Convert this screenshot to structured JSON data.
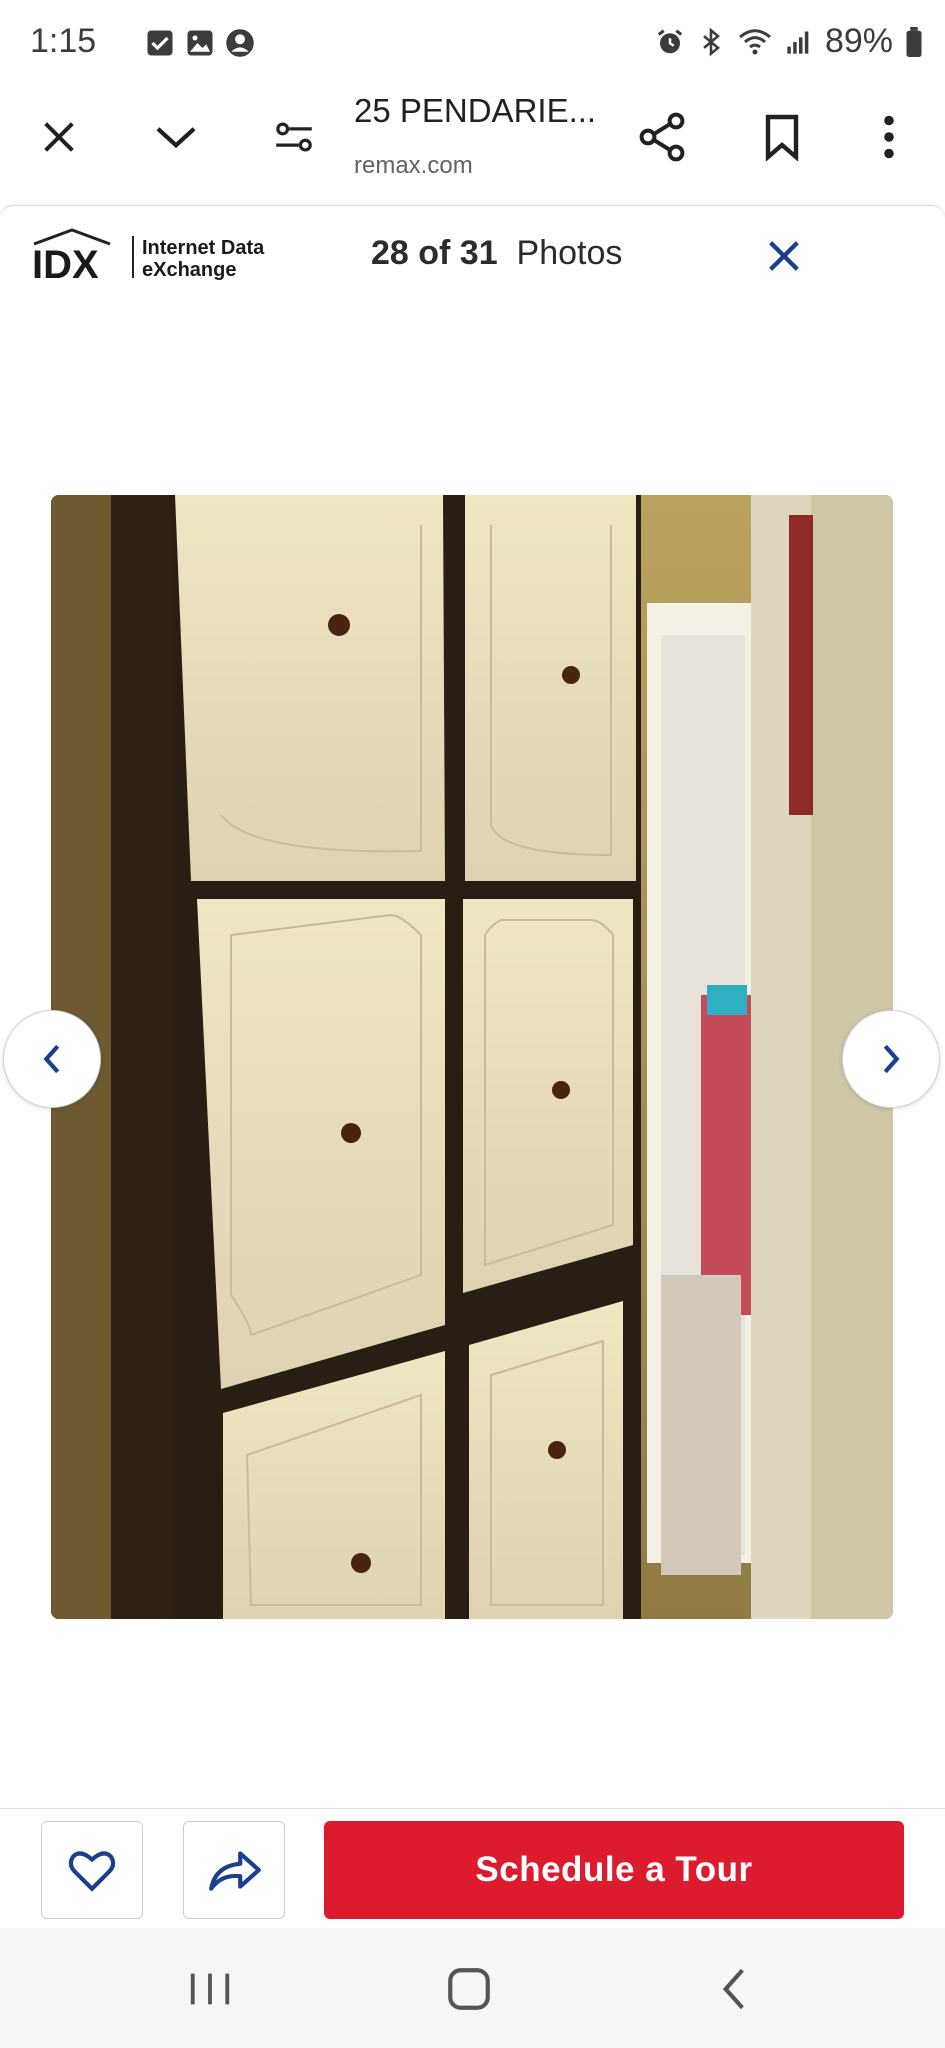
{
  "status_bar": {
    "time": "1:15",
    "battery": "89%",
    "icons": [
      "checkbox-notification-icon",
      "gallery-notification-icon",
      "account-notification-icon",
      "alarm-icon",
      "bluetooth-icon",
      "wifi-icon",
      "signal-icon",
      "battery-icon"
    ]
  },
  "browser": {
    "title": "25 PENDARIE...",
    "domain": "remax.com",
    "icons": [
      "close-icon",
      "chevron-down-icon",
      "page-settings-icon",
      "share-icon",
      "bookmark-icon",
      "more-vert-icon"
    ]
  },
  "gallery": {
    "logo_mark": "IDX",
    "logo_text_line1": "Internet Data",
    "logo_text_line2": "eXchange",
    "counter_number": "28 of 31",
    "counter_label": "Photos",
    "accent_color": "#1a3f8f"
  },
  "actions": {
    "schedule_tour_label": "Schedule a Tour",
    "schedule_tour_color": "#dc1c2e"
  },
  "system_nav": {
    "icons": [
      "recent-apps-icon",
      "home-icon",
      "back-icon"
    ]
  }
}
